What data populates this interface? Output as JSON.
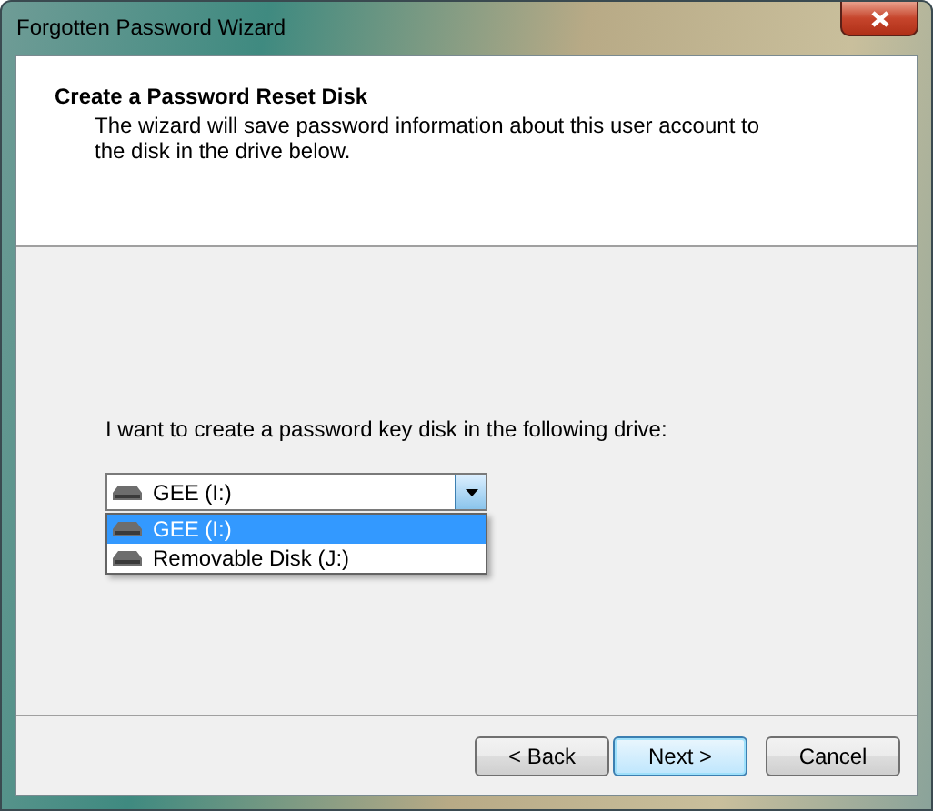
{
  "window": {
    "title": "Forgotten Password Wizard"
  },
  "header": {
    "title": "Create a Password Reset Disk",
    "description": "The wizard will save password information about this user account to the disk in the drive below."
  },
  "prompt": "I want to create a password key disk in the following drive:",
  "drive_combo": {
    "value": "GEE (I:)",
    "expanded": true
  },
  "drive_list": [
    {
      "label": "GEE (I:)",
      "selected": true
    },
    {
      "label": "Removable Disk (J:)",
      "selected": false
    }
  ],
  "buttons": [
    {
      "label": "< Back",
      "default": false
    },
    {
      "label": "Next >",
      "default": true
    },
    {
      "label": "Cancel",
      "default": false
    }
  ]
}
